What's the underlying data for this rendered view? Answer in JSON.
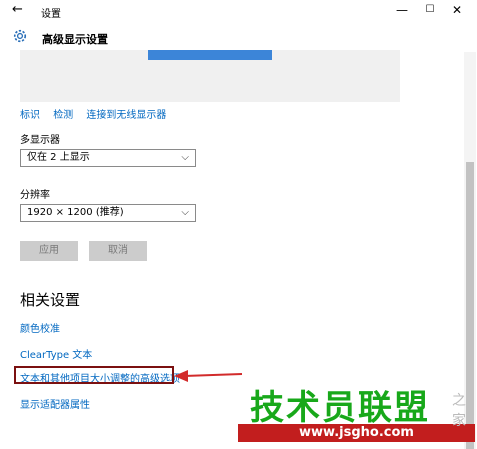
{
  "window": {
    "title": "设置",
    "controls": {
      "minimize": "—",
      "maximize": "☐",
      "close": "✕"
    }
  },
  "header": {
    "icon": "gear-icon",
    "title": "高级显示设置"
  },
  "display_links": [
    "标识",
    "检测",
    "连接到无线显示器"
  ],
  "multi_display": {
    "label": "多显示器",
    "value": "仅在 2 上显示"
  },
  "resolution": {
    "label": "分辨率",
    "value": "1920 × 1200 (推荐)"
  },
  "buttons": {
    "apply": "应用",
    "cancel": "取消"
  },
  "related": {
    "title": "相关设置",
    "links": [
      "颜色校准",
      "ClearType 文本",
      "文本和其他项目大小调整的高级选项",
      "显示适配器属性"
    ]
  },
  "watermark": {
    "text": "技术员联盟",
    "url": "www.jsgho.com",
    "side": "之家"
  },
  "colors": {
    "accent": "#0067c0",
    "highlight_border": "#7b1010",
    "arrow": "#d22b2b",
    "watermark_green": "#18a81a",
    "watermark_red": "#c21e1e"
  }
}
